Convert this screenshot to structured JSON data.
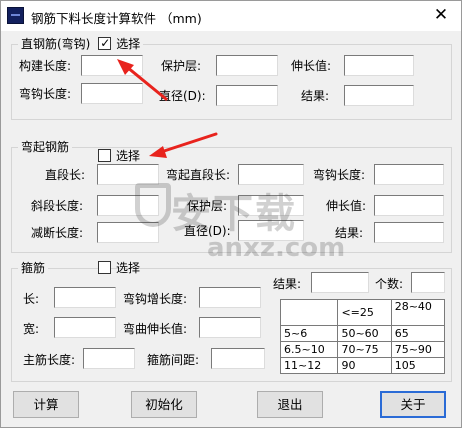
{
  "window": {
    "title": "钢筋下料长度计算软件 （mm)",
    "close_glyph": "✕"
  },
  "section1": {
    "legend": "直钢筋(弯钩)",
    "select_label": "选择",
    "checked": true,
    "labels": {
      "component_length": "构建长度:",
      "cover": "保护层:",
      "extension": "伸长值:",
      "hook_length": "弯钩长度:",
      "diameter": "直径(D):",
      "result": "结果:"
    }
  },
  "section2": {
    "legend": "弯起钢筋",
    "select_label": "选择",
    "checked": false,
    "labels": {
      "straight_length": "直段长:",
      "bent_straight_length": "弯起直段长:",
      "hook_length": "弯钩长度:",
      "oblique_length": "斜段长度:",
      "cover": "保护层:",
      "extension": "伸长值:",
      "cut_length": "减断长度:",
      "diameter": "直径(D):",
      "result": "结果:"
    }
  },
  "section3": {
    "legend": "箍筋",
    "select_label": "选择",
    "checked": false,
    "labels": {
      "length": "长:",
      "hook_increase": "弯钩增长度:",
      "width": "宽:",
      "bend_extension": "弯曲伸长值:",
      "main_bar_length": "主筋长度:",
      "stirrup_spacing": "箍筋间距:",
      "result": "结果:",
      "count": "个数:"
    },
    "reference_table": [
      [
        "",
        "<=25",
        "28~40"
      ],
      [
        "5~6",
        "50~60",
        "65"
      ],
      [
        "6.5~10",
        "70~75",
        "75~90"
      ],
      [
        "11~12",
        "90",
        "105"
      ]
    ]
  },
  "buttons": {
    "calculate": "计算",
    "initialize": "初始化",
    "exit": "退出",
    "about": "关于"
  },
  "watermark": {
    "text": "安下载",
    "sub": "anxz.com"
  },
  "colors": {
    "arrow": "#e8231d",
    "default_button_border": "#2a6bd6"
  }
}
